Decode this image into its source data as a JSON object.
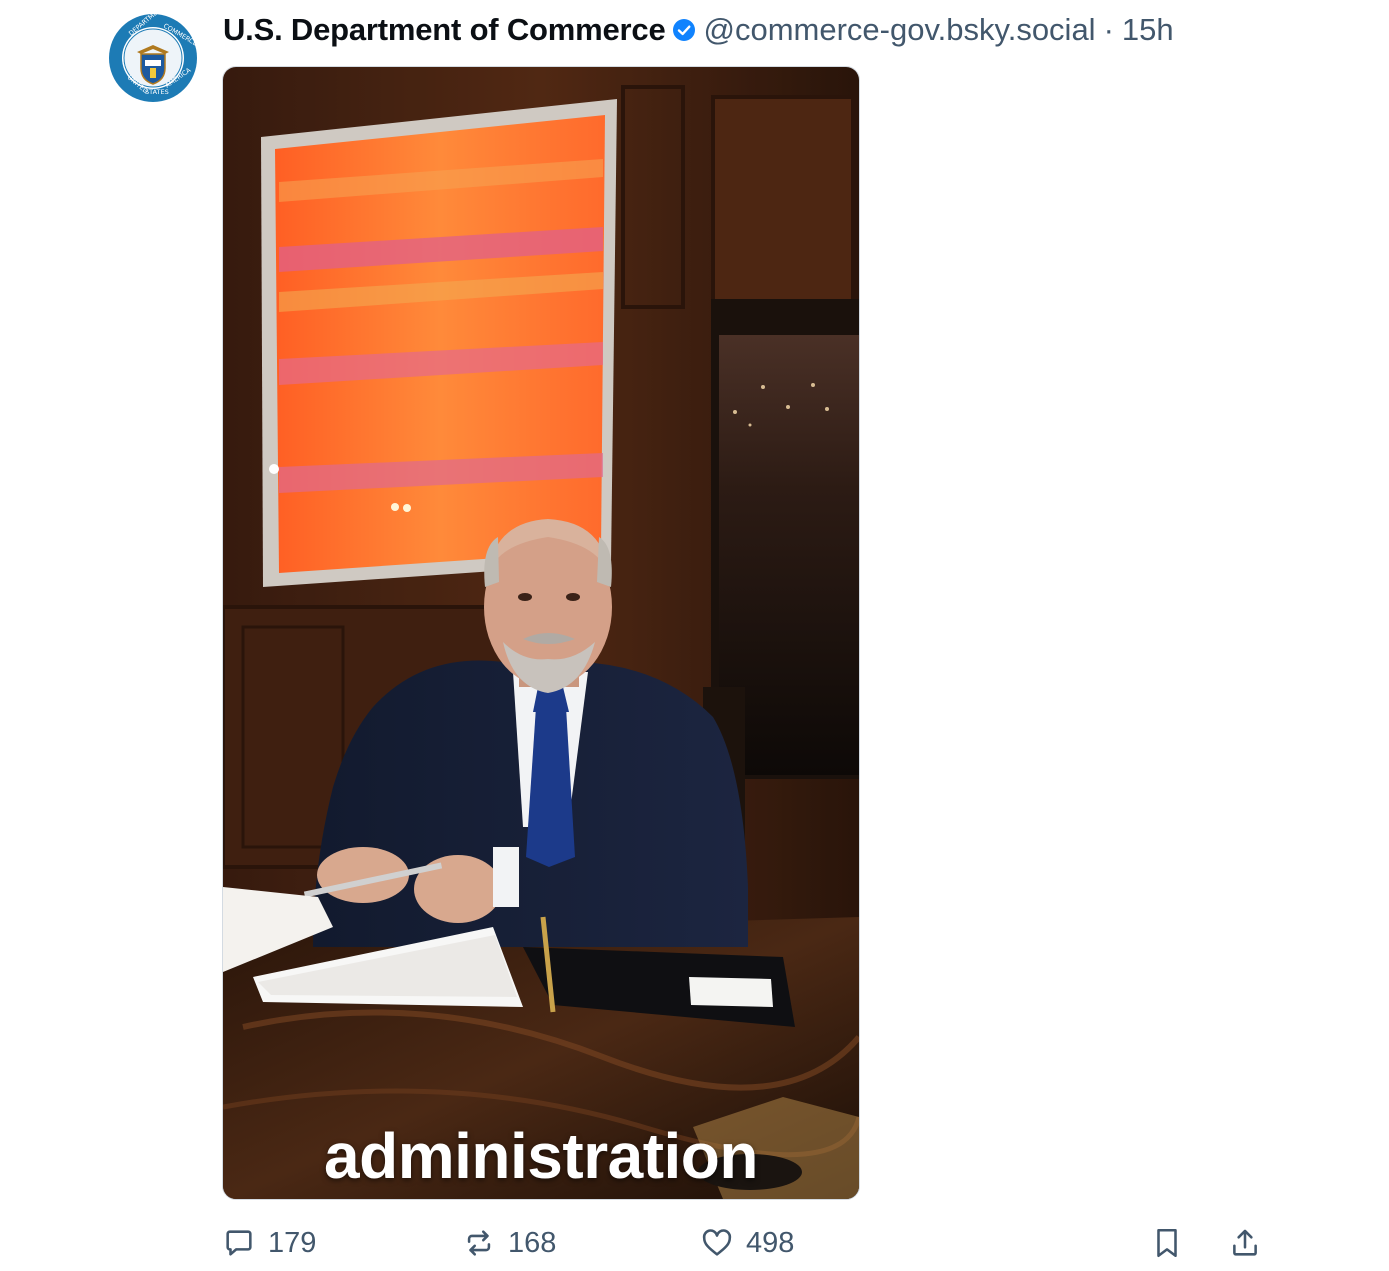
{
  "post": {
    "author": {
      "display_name": "U.S. Department of Commerce",
      "handle": "@commerce-gov.bsky.social",
      "verified": true,
      "avatar_icon": "department-of-commerce-seal"
    },
    "separator": "·",
    "timestamp": "15h",
    "media": {
      "type": "video",
      "caption": "administration"
    },
    "actions": {
      "reply_count": "179",
      "repost_count": "168",
      "like_count": "498"
    }
  },
  "colors": {
    "verified_blue": "#1083fe",
    "meta_gray": "#42576c",
    "seal_blue": "#1d7bb5"
  }
}
